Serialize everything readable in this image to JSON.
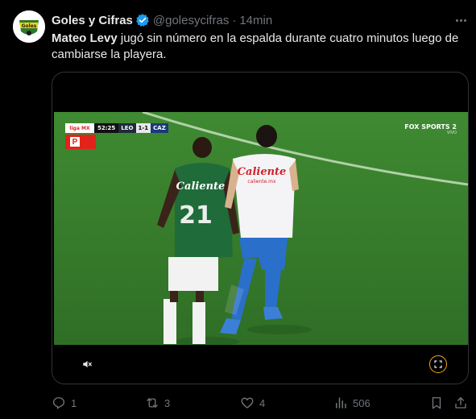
{
  "author": {
    "display_name": "Goles y Cifras",
    "handle": "@golesycifras",
    "separator": "·",
    "time": "14min",
    "avatar_label": "Goles"
  },
  "tweet": {
    "text_bold": "Mateo Levy",
    "text_rest": " jugó sin número en la espalda durante cuatro minutos luego de cambiarse la playera."
  },
  "video": {
    "scorebug": {
      "league_logo": "liga MX",
      "clock": "52:25",
      "home": "LEO",
      "score": "1-1",
      "away": "CAZ"
    },
    "badge_letter": "P",
    "broadcaster": "FOX SPORTS 2",
    "broadcaster_sub": "VIVO",
    "shirt_sponsor": "Caliente",
    "shirt_sponsor_sub": "caliente.mx",
    "home_number": "21"
  },
  "actions": {
    "replies": "1",
    "reposts": "3",
    "likes": "4",
    "views": "506"
  },
  "colors": {
    "background": "#000000",
    "text": "#e7e9ea",
    "muted": "#71767b",
    "verified": "#1d9bf0",
    "fullscreen_accent": "#f4a81d"
  }
}
